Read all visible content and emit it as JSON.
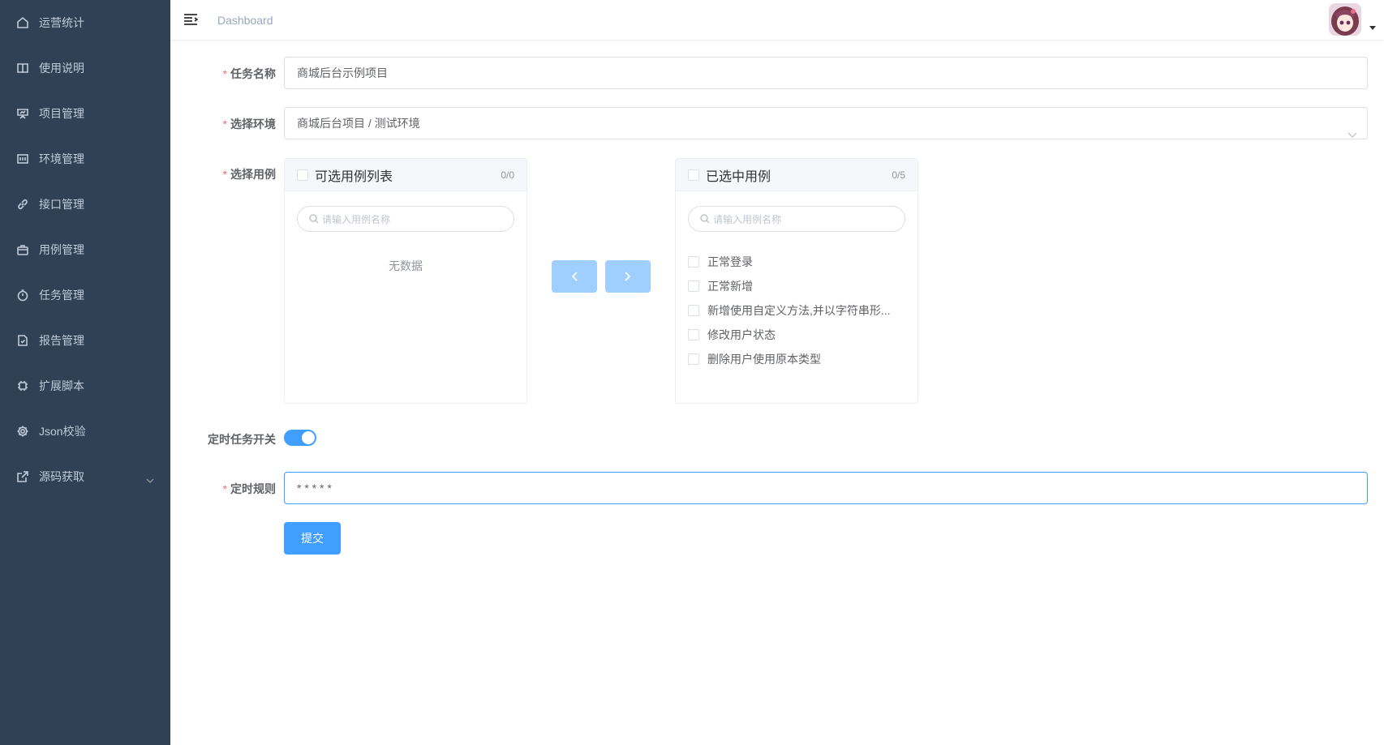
{
  "sidebar": {
    "items": [
      {
        "label": "运营统计",
        "icon": "home-icon"
      },
      {
        "label": "使用说明",
        "icon": "book-icon"
      },
      {
        "label": "项目管理",
        "icon": "presentation-icon"
      },
      {
        "label": "环境管理",
        "icon": "terminal-icon"
      },
      {
        "label": "接口管理",
        "icon": "link-icon"
      },
      {
        "label": "用例管理",
        "icon": "briefcase-icon"
      },
      {
        "label": "任务管理",
        "icon": "timer-icon"
      },
      {
        "label": "报告管理",
        "icon": "document-check-icon"
      },
      {
        "label": "扩展脚本",
        "icon": "cpu-icon"
      },
      {
        "label": "Json校验",
        "icon": "gear-icon"
      },
      {
        "label": "源码获取",
        "icon": "external-link-icon"
      }
    ]
  },
  "navbar": {
    "breadcrumb": "Dashboard"
  },
  "form": {
    "task_name": {
      "label": "任务名称",
      "value": "商城后台示例项目"
    },
    "environment": {
      "label": "选择环境",
      "value": "商城后台项目 / 测试环境"
    },
    "cases": {
      "label": "选择用例"
    },
    "timer_switch": {
      "label": "定时任务开关",
      "on": true
    },
    "timer_rule": {
      "label": "定时规则",
      "value": "* * * * *"
    },
    "submit_label": "提交"
  },
  "transfer": {
    "left": {
      "title": "可选用例列表",
      "count": "0/0",
      "search_placeholder": "请输入用例名称",
      "empty_text": "无数据"
    },
    "right": {
      "title": "已选中用例",
      "count": "0/5",
      "search_placeholder": "请输入用例名称",
      "items": [
        "正常登录",
        "正常新增",
        "新增使用自定义方法,并以字符串形...",
        "修改用户状态",
        "删除用户使用原本类型"
      ]
    }
  },
  "colors": {
    "sidebar_bg": "#304156",
    "primary": "#409eff",
    "primary_disabled": "#a0cfff",
    "required": "#f56c6c"
  }
}
